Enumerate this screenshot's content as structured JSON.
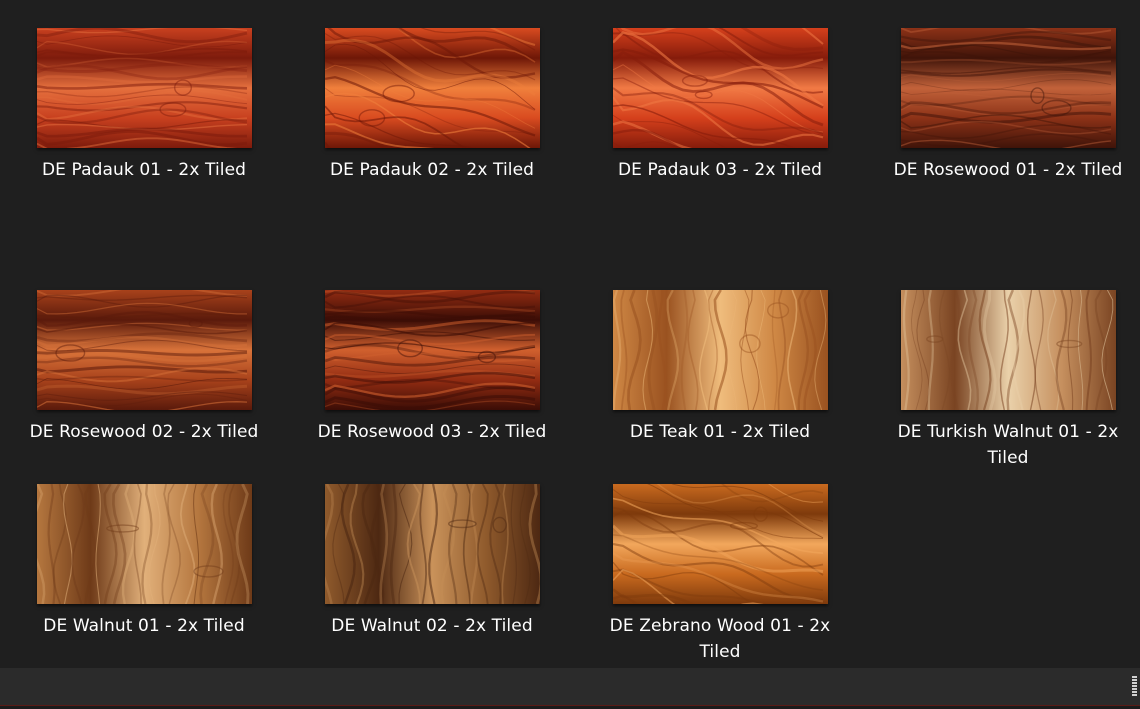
{
  "items": [
    {
      "label": "DE Padauk 01 - 2x Tiled",
      "icon": "padauk-wood-thumbnail",
      "palette": [
        "#7d1b0c",
        "#c8401f",
        "#e5703e"
      ]
    },
    {
      "label": "DE Padauk 02 - 2x Tiled",
      "icon": "padauk-wood-thumbnail",
      "palette": [
        "#6e1707",
        "#d94b20",
        "#f0803c"
      ]
    },
    {
      "label": "DE Padauk 03 - 2x Tiled",
      "icon": "padauk-wood-thumbnail",
      "palette": [
        "#861c0b",
        "#d5401c",
        "#f17a45"
      ]
    },
    {
      "label": "DE Rosewood 01 - 2x Tiled",
      "icon": "rosewood-thumbnail",
      "palette": [
        "#3f1409",
        "#8c3217",
        "#c2623a"
      ]
    },
    {
      "label": "DE Rosewood 02 - 2x Tiled",
      "icon": "rosewood-thumbnail",
      "palette": [
        "#5a1a0b",
        "#a8421b",
        "#d8733a"
      ]
    },
    {
      "label": "DE Rosewood 03 - 2x Tiled",
      "icon": "rosewood-thumbnail",
      "palette": [
        "#3b0d06",
        "#922c12",
        "#d0602e"
      ]
    },
    {
      "label": "DE Teak 01 - 2x Tiled",
      "icon": "teak-thumbnail",
      "palette": [
        "#9a5220",
        "#cf8845",
        "#efbc7c"
      ]
    },
    {
      "label": "DE Turkish Walnut 01 - 2x Tiled",
      "icon": "turkish-walnut-thumbnail",
      "palette": [
        "#7a4422",
        "#c58f5e",
        "#ead1aa"
      ]
    },
    {
      "label": "DE Walnut 01 - 2x Tiled",
      "icon": "walnut-thumbnail",
      "palette": [
        "#6e3a18",
        "#b5773f",
        "#e1b07a"
      ]
    },
    {
      "label": "DE Walnut 02 - 2x Tiled",
      "icon": "walnut-thumbnail",
      "palette": [
        "#4d2812",
        "#8f5a2c",
        "#c9925a"
      ]
    },
    {
      "label": "DE Zebrano Wood 01 - 2x Tiled",
      "icon": "zebrano-thumbnail",
      "palette": [
        "#7e3a0c",
        "#c96a1f",
        "#f2a75c"
      ]
    }
  ]
}
